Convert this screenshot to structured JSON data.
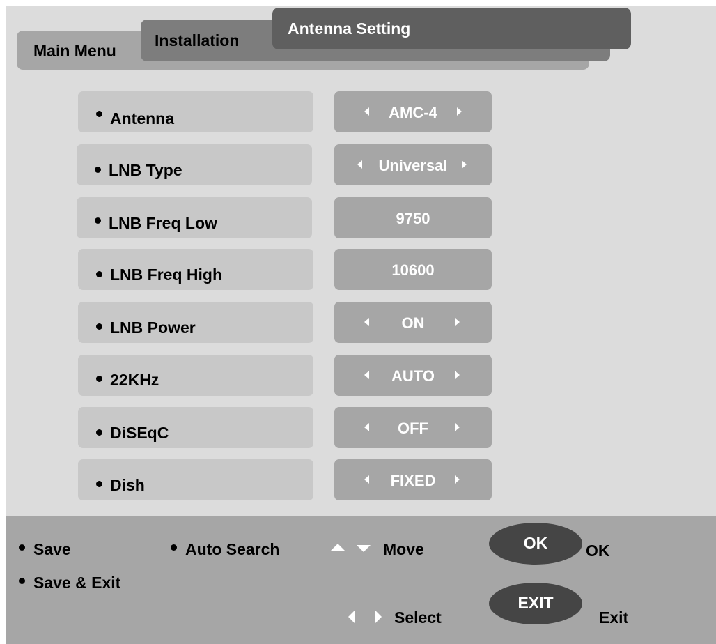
{
  "header": {
    "tabs": [
      {
        "label": "Main Menu"
      },
      {
        "label": "Installation"
      },
      {
        "label": "Antenna Setting"
      }
    ]
  },
  "settings": [
    {
      "label": "Antenna",
      "value": "AMC-4",
      "has_arrows": true
    },
    {
      "label": "LNB Type",
      "value": "Universal",
      "has_arrows": true
    },
    {
      "label": "LNB Freq Low",
      "value": "9750",
      "has_arrows": false
    },
    {
      "label": "LNB Freq High",
      "value": "10600",
      "has_arrows": false
    },
    {
      "label": "LNB Power",
      "value": "ON",
      "has_arrows": true
    },
    {
      "label": "22KHz",
      "value": "AUTO",
      "has_arrows": true
    },
    {
      "label": "DiSEqC",
      "value": "OFF",
      "has_arrows": true
    },
    {
      "label": "Dish",
      "value": "FIXED",
      "has_arrows": true
    }
  ],
  "footer": {
    "save": "Save",
    "auto_search": "Auto Search",
    "move": "Move",
    "ok_button": "OK",
    "ok_label": "OK",
    "save_exit": "Save & Exit",
    "select": "Select",
    "exit_button": "EXIT",
    "exit_label": "Exit"
  },
  "colors": {
    "background": "#dcdcdc",
    "row_label_bg": "#c8c8c8",
    "row_value_bg": "#a6a6a6",
    "active_tab": "#5f5f5f",
    "button_oval": "#454545"
  }
}
